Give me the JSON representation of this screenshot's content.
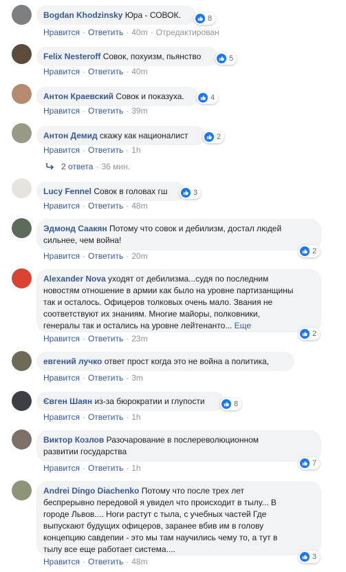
{
  "colors": {
    "link": "#385898",
    "bubble": "#f2f3f5",
    "like_blue": "#1877f2",
    "meta": "#90949c"
  },
  "labels": {
    "like": "Нравится",
    "reply": "Ответить",
    "edited": "Отредактирован",
    "sep": "·"
  },
  "comments": [
    {
      "author": "Bogdan Khodzinsky",
      "text": "Юра - СОВОК.",
      "reactions": "8",
      "time": "40m",
      "edited": true
    },
    {
      "author": "Felix Nesteroff",
      "text": "Совок, похуизм, пьянство",
      "reactions": "5",
      "time": "40m"
    },
    {
      "author": "Антон Краевский",
      "text": "Совок и показуха.",
      "reactions": "4",
      "time": "39m"
    },
    {
      "author": "Антон Демид",
      "text": "скажу как националист",
      "reactions": "2",
      "time": "1h",
      "replies": {
        "label": "2 ответа",
        "time": "36 мин."
      }
    },
    {
      "author": "Lucy Fennel",
      "text": "Совок в головах гш",
      "reactions": "3",
      "time": "48m"
    },
    {
      "author": "Эдмонд Саакян",
      "text_lines": [
        "Потому что совок и дебилизм, достал людей",
        "сильнее, чем война!"
      ],
      "reactions": "2",
      "time": "20m"
    },
    {
      "author": "Alexander Nova",
      "text_lines": [
        "уходят от дебилизма...судя по последним",
        "новостям отношение в армии как было на уровне партизанщины",
        "так и осталось.  Офицеров толковых очень мало. Звания не",
        "соответствуют их знаниям. Многие майоры, полковники,",
        "генералы так и остались на уровне лейтенанто..."
      ],
      "more": "Еще",
      "reactions": "2",
      "time": "23m"
    },
    {
      "author": "евгений лучко",
      "text": "ответ прост когда это не война а политика,",
      "time": "3m"
    },
    {
      "author": "Євген Шаян",
      "text": "из-за бюрократии и глупости",
      "reactions": "8",
      "time": "1h"
    },
    {
      "author": "Виктор Козлов",
      "text_lines": [
        "Разочарование в послереволюционном",
        "развитии государства"
      ],
      "reactions": "7",
      "time": "1h"
    },
    {
      "author": "Andrei Dingo Diachenko",
      "text_lines": [
        "Потому что после трех лет",
        "беспрерывно передовой я увидел что происходит в тылу... В",
        "городе Львов.... Ноги растут с тыла, с учебных частей Где",
        "выпускают будущих офицеров, заранее вбив им в голову",
        "концепцию савдепии - это мы там научились чему то, а тут в",
        "тылу все еще работает система...."
      ],
      "reactions": "3",
      "time": "48m"
    }
  ]
}
